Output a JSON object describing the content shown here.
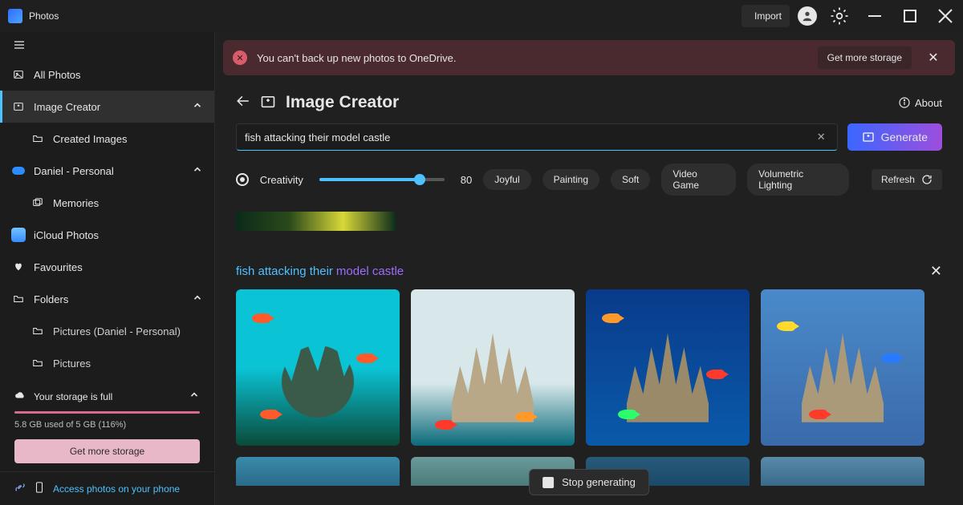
{
  "app": {
    "name": "Photos"
  },
  "titlebar": {
    "import": "Import"
  },
  "sidebar": {
    "all_photos": "All Photos",
    "image_creator": "Image Creator",
    "created_images": "Created Images",
    "account": "Daniel - Personal",
    "memories": "Memories",
    "icloud": "iCloud Photos",
    "favourites": "Favourites",
    "folders": "Folders",
    "folder1": "Pictures (Daniel - Personal)",
    "folder2": "Pictures"
  },
  "storage": {
    "title": "Your storage is full",
    "usage": "5.8 GB used of 5 GB (116%)",
    "percent": 100,
    "cta": "Get more storage"
  },
  "phone_link": "Access photos on your phone",
  "alert": {
    "text": "You can't back up new photos to OneDrive.",
    "cta": "Get more storage"
  },
  "page": {
    "title": "Image Creator",
    "about": "About"
  },
  "prompt": {
    "value": "fish attacking their model castle ",
    "generate": "Generate"
  },
  "controls": {
    "creativity_label": "Creativity",
    "creativity_value": "80",
    "creativity_pct": 80,
    "tags": [
      "Joyful",
      "Painting",
      "Soft",
      "Video Game",
      "Volumetric Lighting"
    ],
    "refresh": "Refresh"
  },
  "result": {
    "title_a": "fish attacking their ",
    "title_b": "model castle"
  },
  "stop": "Stop generating"
}
